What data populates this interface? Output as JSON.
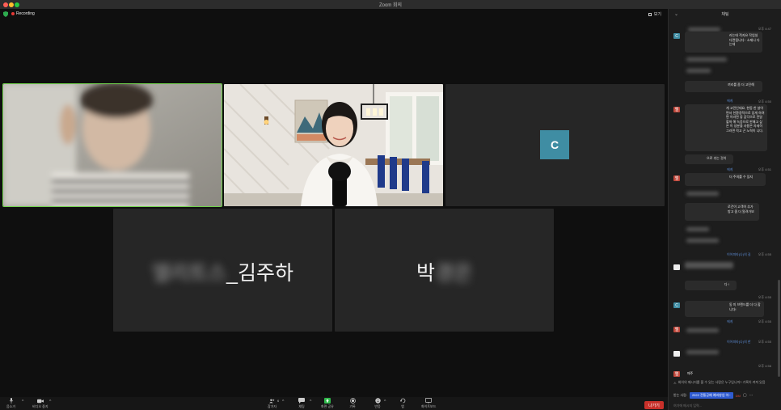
{
  "window": {
    "title": "Zoom 회의"
  },
  "meeting": {
    "recording_label": "Recording",
    "view_label": "보기",
    "tiles": [
      {
        "id": "tile-1",
        "type": "video"
      },
      {
        "id": "tile-2",
        "type": "video"
      },
      {
        "id": "tile-3",
        "type": "avatar",
        "initial": "C"
      },
      {
        "id": "tile-4",
        "type": "name",
        "name_hidden": "엘리트스",
        "name_visible": "_김주하"
      },
      {
        "id": "tile-5",
        "type": "name",
        "name_visible": "박",
        "name_hidden": "경은"
      }
    ]
  },
  "toolbar": {
    "audio": "음소거",
    "video": "비디오 중지",
    "participants": "참가자",
    "participants_count": "6",
    "chat": "채팅",
    "share": "화면 공유",
    "record": "기록",
    "reactions": "반응",
    "apps": "앱",
    "whiteboard": "화이트보드",
    "leave": "나가기"
  },
  "chat": {
    "header": "채팅",
    "messages": [
      {
        "avatar": "C",
        "avatar_color": "teal",
        "sender": "",
        "time": "오후 4:47",
        "text": "라는데 적지요 작업실 다면됩니다~ 소재나 다는데"
      },
      {
        "avatar": "",
        "avatar_color": "",
        "sender": "",
        "time": "",
        "text": "끼리를 좀 더 고민해"
      },
      {
        "avatar": "엘",
        "avatar_color": "red",
        "sender": "에게",
        "time": "오후 4:50",
        "text": "게 고민인데요, 현동 한 살이면서 친환경적으로 있게 하려면 이러면 좋 감각으로 전달할까 해 녹웅으로 판매고 싶은 이 성분을 사용은 자세히 그러면 적고 곤 노력이 니다."
      },
      {
        "avatar": "",
        "avatar_color": "",
        "sender": "",
        "time": "",
        "text": "으로 추는 것이"
      },
      {
        "avatar": "엘",
        "avatar_color": "red",
        "sender": "에게",
        "time": "오후 4:51",
        "text": "더 주의를 수 있지"
      },
      {
        "avatar": "",
        "avatar_color": "",
        "sender": "",
        "time": "",
        "text": "로건이 고객이 추가 방고 좀 더 알려가보"
      },
      {
        "avatar": "",
        "avatar_color": "white",
        "sender": "이어피타(나)의 길",
        "time": "오후 4:55",
        "text": ""
      },
      {
        "avatar": "",
        "avatar_color": "",
        "sender": "",
        "time": "",
        "text": "다 !"
      },
      {
        "avatar": "C",
        "avatar_color": "teal",
        "sender": "",
        "time": "오후 4:55",
        "text": "동 미 브랜드를 더 다 합니다!"
      },
      {
        "avatar": "엘",
        "avatar_color": "red",
        "sender": "에게",
        "time": "오후 4:55",
        "text": ""
      },
      {
        "avatar": "",
        "avatar_color": "white",
        "sender": "이어피타(나)의 한",
        "time": "오후 4:55",
        "text": ""
      },
      {
        "avatar": "엘",
        "avatar_color": "red",
        "sender": "",
        "time": "오후 4:56",
        "text": "매주"
      }
    ],
    "warning": "회의의 메시지를 볼 수 있는 사람은 누구입니까? 기록이 켜져 있음",
    "send_to_label": "받는 사람:",
    "send_to_value": "2022 전통공예 예비창업 아~",
    "send_to_more": "DM",
    "input_placeholder": "여기에 메시지 입력..."
  }
}
